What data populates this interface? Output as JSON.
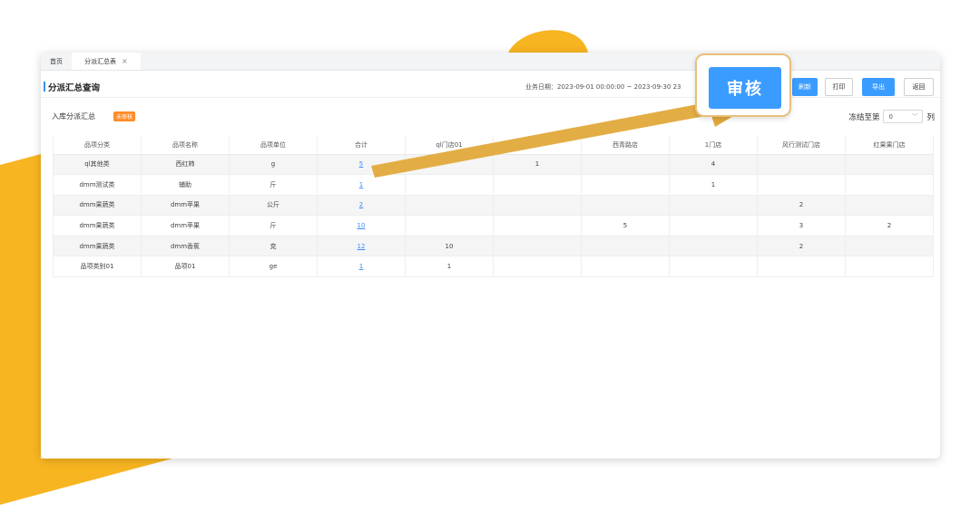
{
  "tabs": [
    {
      "label": "首页"
    },
    {
      "label": "分派汇总表",
      "close": "×"
    }
  ],
  "header": {
    "title": "分派汇总查询",
    "date_range": "业务日期：2023-09-01 00:00:00 ~ 2023-09-30 23",
    "buttons": {
      "refresh": "刷新",
      "print": "打印",
      "export": "导出",
      "back": "返回"
    }
  },
  "sub": {
    "title": "入库分派汇总",
    "badge": "未审核",
    "freeze_prefix": "冻结至第",
    "freeze_value": "0",
    "freeze_suffix": "列"
  },
  "table": {
    "columns": [
      "品项分类",
      "品项名称",
      "品项单位",
      "合计",
      "ql门店01",
      "",
      "西青路店",
      "1门店",
      "风行测试门店",
      "红果果门店"
    ],
    "rows": [
      [
        "ql其他类",
        "西红柿",
        "g",
        "5",
        "",
        "1",
        "",
        "4",
        "",
        ""
      ],
      [
        "dmm测试类",
        "辅助",
        "斤",
        "1",
        "",
        "",
        "",
        "1",
        "",
        ""
      ],
      [
        "dmm果蔬类",
        "dmm苹果",
        "公斤",
        "2",
        "",
        "",
        "",
        "",
        "2",
        ""
      ],
      [
        "dmm果蔬类",
        "dmm苹果",
        "斤",
        "10",
        "",
        "",
        "5",
        "",
        "3",
        "2"
      ],
      [
        "dmm果蔬类",
        "dmm香蕉",
        "克",
        "12",
        "10",
        "",
        "",
        "",
        "2",
        ""
      ],
      [
        "品项类别01",
        "品项01",
        "ge",
        "1",
        "1",
        "",
        "",
        "",
        "",
        ""
      ]
    ]
  },
  "callout": {
    "label": "审核"
  },
  "colors": {
    "accent": "#3b9cff",
    "brand_yellow": "#f7b521",
    "arrow": "#e2a93b",
    "badge": "#ff8c2a"
  }
}
